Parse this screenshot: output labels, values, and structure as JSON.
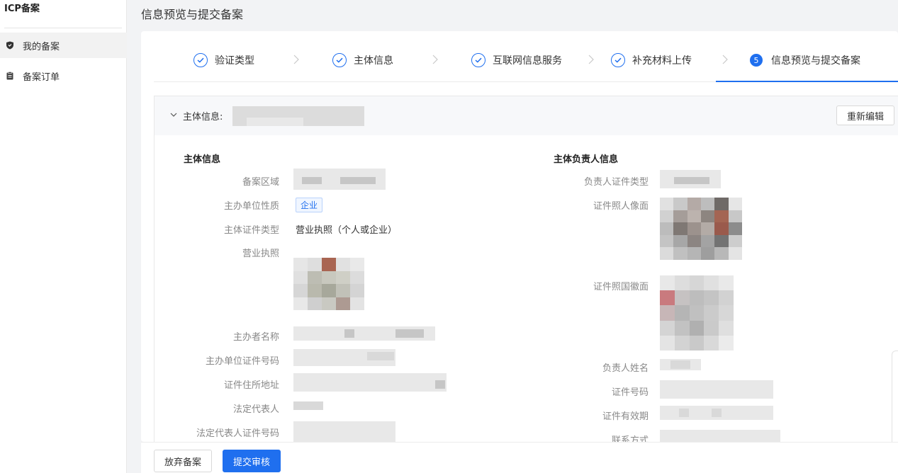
{
  "app": {
    "title": "ICP备案"
  },
  "sidebar": {
    "items": [
      {
        "label": "我的备案",
        "icon": "shield-icon",
        "active": true
      },
      {
        "label": "备案订单",
        "icon": "clipboard-icon",
        "active": false
      }
    ]
  },
  "page": {
    "title": "信息预览与提交备案"
  },
  "steps": [
    {
      "label": "验证类型",
      "status": "done"
    },
    {
      "label": "主体信息",
      "status": "done"
    },
    {
      "label": "互联网信息服务",
      "status": "done"
    },
    {
      "label": "补充材料上传",
      "status": "done"
    },
    {
      "label": "信息预览与提交备案",
      "status": "current",
      "number": "5"
    }
  ],
  "panel": {
    "header_label": "主体信息:",
    "reedit_label": "重新编辑"
  },
  "subject": {
    "title": "主体信息",
    "fields": {
      "region_label": "备案区域",
      "unit_nature_label": "主办单位性质",
      "unit_nature_value": "企业",
      "cert_type_label": "主体证件类型",
      "cert_type_value": "营业执照（个人或企业）",
      "license_label": "营业执照",
      "sponsor_name_label": "主办者名称",
      "unit_cert_no_label": "主办单位证件号码",
      "cert_address_label": "证件住所地址",
      "legal_rep_label": "法定代表人",
      "legal_rep_cert_label": "法定代表人证件号码"
    }
  },
  "principal": {
    "title": "主体负责人信息",
    "fields": {
      "cert_type_label": "负责人证件类型",
      "photo_front_label": "证件照人像面",
      "photo_back_label": "证件照国徽面",
      "name_label": "负责人姓名",
      "cert_no_label": "证件号码",
      "validity_label": "证件有效期",
      "contact_label": "联系方式"
    }
  },
  "footer": {
    "abandon_label": "放弃备案",
    "submit_label": "提交审核"
  },
  "colors": {
    "primary": "#1f6fef",
    "tag_bg": "#f0f6ff",
    "label_gray": "#888888"
  }
}
